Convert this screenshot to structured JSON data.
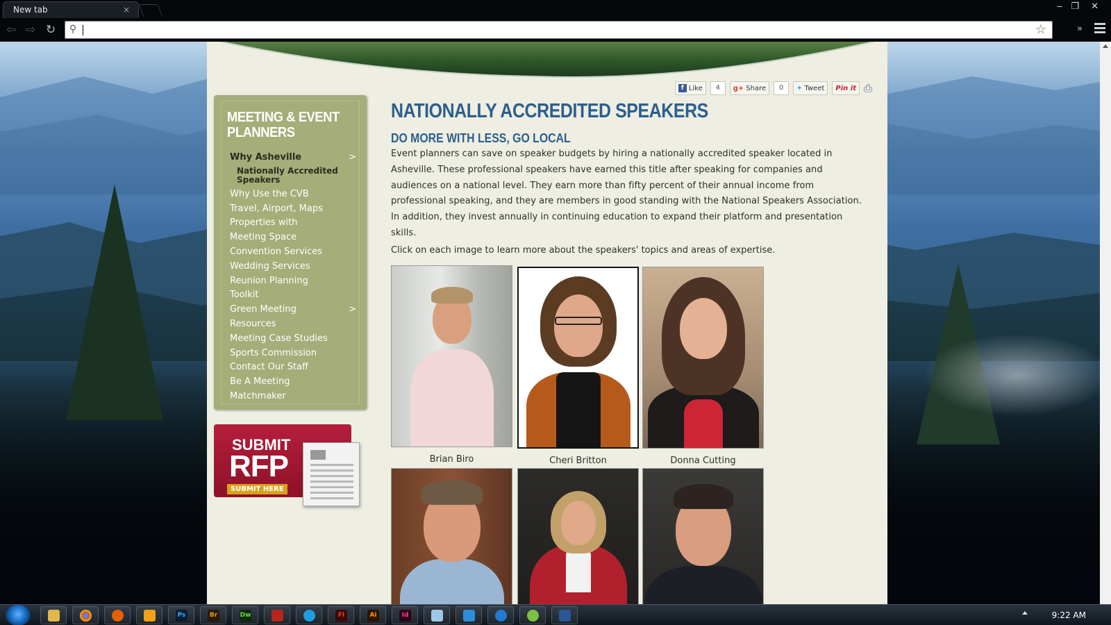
{
  "browser": {
    "tab_title": "New tab",
    "tab_close": "×",
    "address_value": "",
    "win_min": "‒",
    "win_max": "❐",
    "win_close": "✕",
    "overflow": "»"
  },
  "share_bar": {
    "like_label": "Like",
    "like_count": "4",
    "share_label": "Share",
    "share_count": "0",
    "tweet_label": "Tweet",
    "pin_label": "Pin it"
  },
  "sidebar": {
    "title": "MEETING & EVENT PLANNERS",
    "items": [
      {
        "label": "Why Asheville",
        "arrow": ">"
      },
      {
        "label": "Nationally Accredited Speakers"
      },
      {
        "label": "Why Use the CVB"
      },
      {
        "label": "Travel, Airport, Maps"
      },
      {
        "label": "Properties with"
      },
      {
        "label": "Meeting Space"
      },
      {
        "label": "Convention Services"
      },
      {
        "label": "Wedding Services"
      },
      {
        "label": "Reunion Planning"
      },
      {
        "label": "Toolkit"
      },
      {
        "label": "Green Meeting",
        "arrow": ">"
      },
      {
        "label": "Resources"
      },
      {
        "label": "Meeting Case Studies"
      },
      {
        "label": "Sports Commission"
      },
      {
        "label": "Contact Our Staff"
      },
      {
        "label": "Be A Meeting"
      },
      {
        "label": "Matchmaker"
      }
    ]
  },
  "rfp": {
    "line1": "SUBMIT",
    "line2": "RFP",
    "cta": "SUBMIT HERE"
  },
  "main": {
    "title": "NATIONALLY ACCREDITED SPEAKERS",
    "subtitle": "DO MORE WITH LESS, GO LOCAL",
    "body": "Event planners can save on speaker budgets by hiring a nationally accredited speaker located in Asheville. These professional speakers have earned this title after speaking for companies and audiences on a national level. They earn more than fifty percent of their annual income from professional speaking, and they are members in good standing with the National Speakers Association. In addition, they invest annually in continuing education to expand their platform and presentation skills.",
    "click_note": "Click on each image to learn more about the speakers' topics and areas of expertise.",
    "speakers": [
      {
        "name": "Brian Biro"
      },
      {
        "name": "Cheri Britton"
      },
      {
        "name": "Donna Cutting"
      },
      {
        "name": ""
      },
      {
        "name": ""
      },
      {
        "name": ""
      }
    ]
  },
  "taskbar": {
    "clock": "9:22 AM"
  },
  "colors": {
    "heading_blue": "#2c5f8e",
    "sidebar_green": "#a5ad79",
    "page_bg": "#eeeee2",
    "rfp_red": "#b51e3c"
  }
}
